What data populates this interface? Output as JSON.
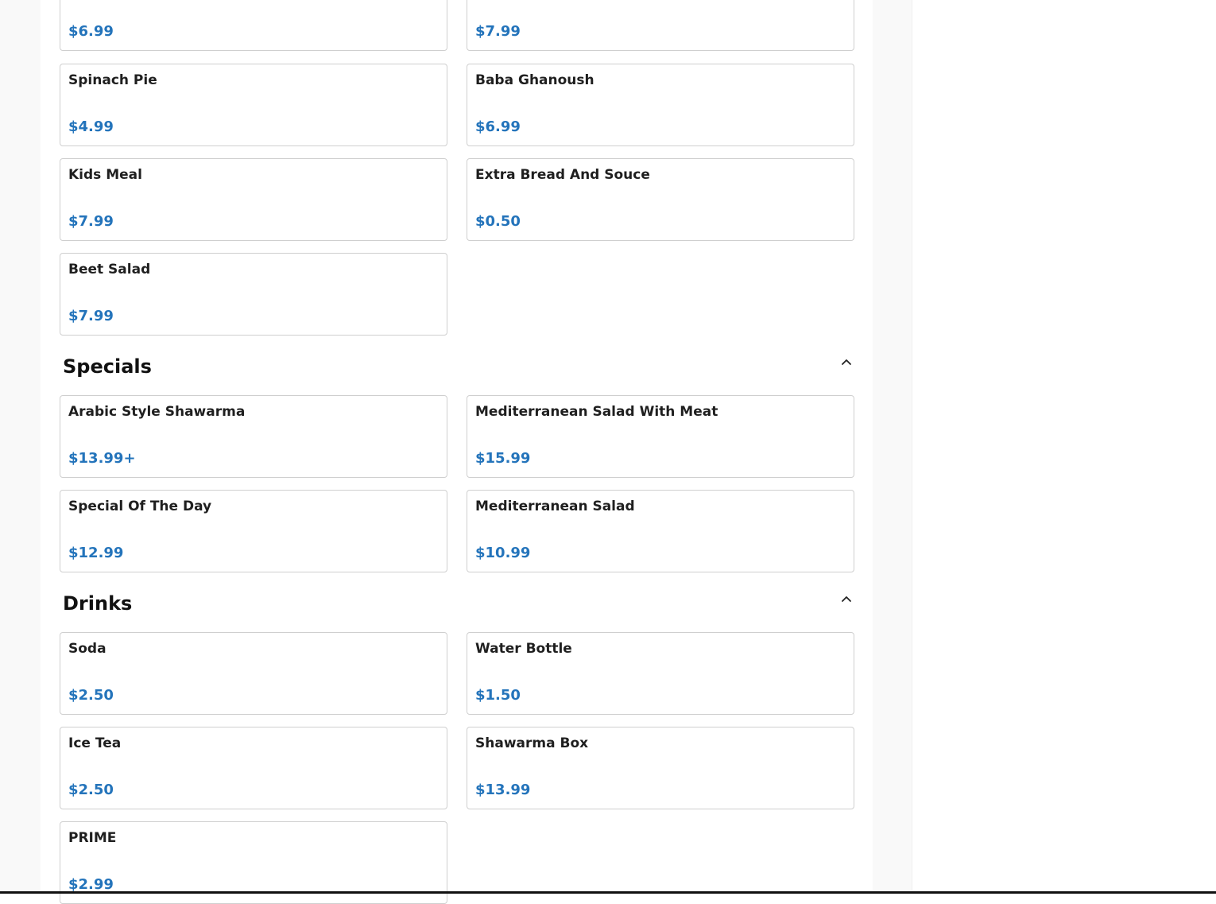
{
  "top_partial": {
    "items": [
      {
        "price": "$6.99"
      },
      {
        "price": "$7.99"
      }
    ]
  },
  "appetizers": {
    "items": [
      {
        "name": "Spinach Pie",
        "price": "$4.99"
      },
      {
        "name": "Baba Ghanoush",
        "price": "$6.99"
      },
      {
        "name": "Kids Meal",
        "price": "$7.99"
      },
      {
        "name": "Extra Bread And Souce",
        "price": "$0.50"
      },
      {
        "name": "Beet Salad",
        "price": "$7.99"
      }
    ]
  },
  "specials": {
    "title": "Specials",
    "collapse_icon": "chevron-up-icon",
    "items": [
      {
        "name": "Arabic Style Shawarma",
        "price": "$13.99+"
      },
      {
        "name": "Mediterranean Salad With Meat",
        "price": "$15.99"
      },
      {
        "name": "Special Of The Day",
        "price": "$12.99"
      },
      {
        "name": "Mediterranean Salad",
        "price": "$10.99"
      }
    ]
  },
  "drinks": {
    "title": "Drinks",
    "collapse_icon": "chevron-up-icon",
    "items": [
      {
        "name": "Soda",
        "price": "$2.50"
      },
      {
        "name": "Water Bottle",
        "price": "$1.50"
      },
      {
        "name": "Ice Tea",
        "price": "$2.50"
      },
      {
        "name": "Shawarma Box",
        "price": "$13.99"
      },
      {
        "name": "PRIME",
        "price": "$2.99"
      }
    ]
  },
  "colors": {
    "price": "#2474bb",
    "name": "#1f1f1f",
    "border": "#cfcfcf"
  }
}
